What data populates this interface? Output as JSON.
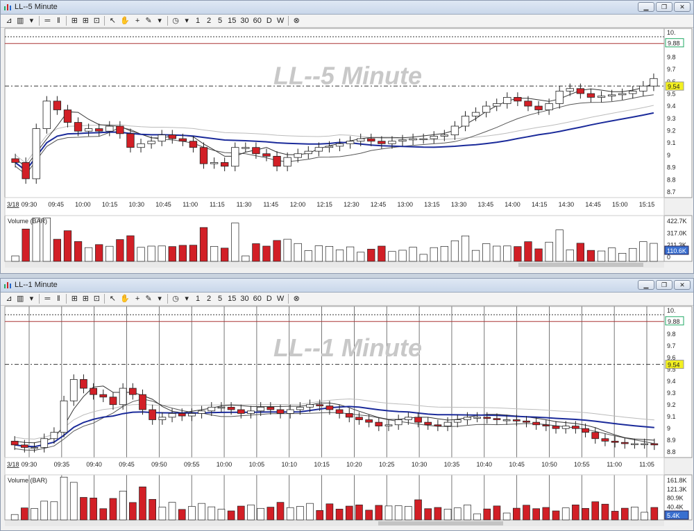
{
  "top_window": {
    "title": "LL--5 Minute",
    "toolbar": [
      "1",
      "2",
      "5",
      "15",
      "30",
      "60",
      "D",
      "W"
    ],
    "watermark": "LL--5 Minute",
    "date_label": "3/18",
    "volume_label": "Volume (BAR)",
    "price_axis": [
      "10.",
      "9.9",
      "9.8",
      "9.7",
      "9.6",
      "9.5",
      "9.4",
      "9.3",
      "9.2",
      "9.1",
      "9",
      "8.9",
      "8.8",
      "8.7"
    ],
    "volume_axis": [
      "422.7K",
      "317.0K",
      "211.3K",
      "0"
    ],
    "price_flags": {
      "upper": "9.88",
      "current": "9.54"
    },
    "volume_flag": "110.6K",
    "time_axis": [
      "09:30",
      "09:45",
      "10:00",
      "10:15",
      "10:30",
      "10:45",
      "11:00",
      "11:15",
      "11:30",
      "11:45",
      "12:00",
      "12:15",
      "12:30",
      "12:45",
      "13:00",
      "13:15",
      "13:30",
      "13:45",
      "14:00",
      "14:15",
      "14:30",
      "14:45",
      "15:00",
      "15:15"
    ]
  },
  "bottom_window": {
    "title": "LL--1 Minute",
    "toolbar": [
      "1",
      "2",
      "5",
      "15",
      "30",
      "60",
      "D",
      "W"
    ],
    "watermark": "LL--1 Minute",
    "date_label": "3/18",
    "volume_label": "Volume (BAR)",
    "price_axis": [
      "10.",
      "9.9",
      "9.8",
      "9.7",
      "9.6",
      "9.5",
      "9.4",
      "9.3",
      "9.2",
      "9.1",
      "9",
      "8.9",
      "8.8"
    ],
    "volume_axis": [
      "161.8K",
      "121.3K",
      "80.9K",
      "40.4K",
      "5.4K"
    ],
    "price_flags": {
      "upper": "9.88",
      "current": "9.54"
    },
    "volume_flag": "5.4K",
    "time_axis": [
      "09:30",
      "09:35",
      "09:40",
      "09:45",
      "09:50",
      "09:55",
      "10:00",
      "10:05",
      "10:10",
      "10:15",
      "10:20",
      "10:25",
      "10:30",
      "10:35",
      "10:40",
      "10:45",
      "10:50",
      "10:55",
      "11:00",
      "11:05"
    ]
  },
  "chart_data": [
    {
      "type": "candlestick",
      "title": "LL--5 Minute",
      "ylim": [
        8.65,
        10.0
      ],
      "x_ticks": [
        "09:30",
        "09:45",
        "10:00",
        "10:15",
        "10:30",
        "10:45",
        "11:00",
        "11:15",
        "11:30",
        "11:45",
        "12:00",
        "12:15",
        "12:30",
        "12:45",
        "13:00",
        "13:15",
        "13:30",
        "13:45",
        "14:00",
        "14:15",
        "14:30",
        "14:45",
        "15:00",
        "15:15"
      ],
      "closes": [
        8.93,
        8.8,
        9.2,
        9.42,
        9.35,
        9.25,
        9.18,
        9.2,
        9.18,
        9.22,
        9.16,
        9.05,
        9.08,
        9.1,
        9.15,
        9.12,
        9.1,
        9.05,
        8.92,
        8.93,
        8.9,
        9.05,
        9.05,
        9.0,
        8.98,
        8.9,
        8.97,
        9.0,
        9.02,
        9.05,
        9.06,
        9.08,
        9.1,
        9.12,
        9.1,
        9.08,
        9.1,
        9.11,
        9.12,
        9.12,
        9.14,
        9.15,
        9.22,
        9.3,
        9.33,
        9.38,
        9.4,
        9.45,
        9.42,
        9.38,
        9.35,
        9.4,
        9.5,
        9.52,
        9.48,
        9.45,
        9.46,
        9.47,
        9.48,
        9.5,
        9.54,
        9.6
      ],
      "volume_ylim": [
        0,
        422.7
      ],
      "upper_level": 9.88,
      "current_price": 9.54
    },
    {
      "type": "candlestick",
      "title": "LL--1 Minute",
      "ylim": [
        8.8,
        10.0
      ],
      "x_ticks": [
        "09:30",
        "09:35",
        "09:40",
        "09:45",
        "09:50",
        "09:55",
        "10:00",
        "10:05",
        "10:10",
        "10:15",
        "10:20",
        "10:25",
        "10:30",
        "10:35",
        "10:40",
        "10:45",
        "10:50",
        "10:55",
        "11:00",
        "11:05"
      ],
      "closes": [
        8.9,
        8.88,
        8.88,
        8.95,
        9.0,
        9.25,
        9.42,
        9.35,
        9.3,
        9.28,
        9.22,
        9.35,
        9.3,
        9.18,
        9.1,
        9.12,
        9.15,
        9.13,
        9.15,
        9.17,
        9.2,
        9.2,
        9.18,
        9.15,
        9.17,
        9.2,
        9.18,
        9.15,
        9.18,
        9.2,
        9.22,
        9.21,
        9.18,
        9.15,
        9.12,
        9.1,
        9.08,
        9.05,
        9.06,
        9.1,
        9.12,
        9.08,
        9.06,
        9.05,
        9.08,
        9.1,
        9.12,
        9.12,
        9.11,
        9.1,
        9.1,
        9.09,
        9.08,
        9.06,
        9.05,
        9.03,
        9.05,
        9.03,
        9.0,
        8.95,
        8.93,
        8.92,
        8.91,
        8.91,
        8.91,
        8.9
      ],
      "volume_ylim": [
        0,
        161.8
      ],
      "upper_level": 9.88,
      "current_price": 9.54
    }
  ]
}
